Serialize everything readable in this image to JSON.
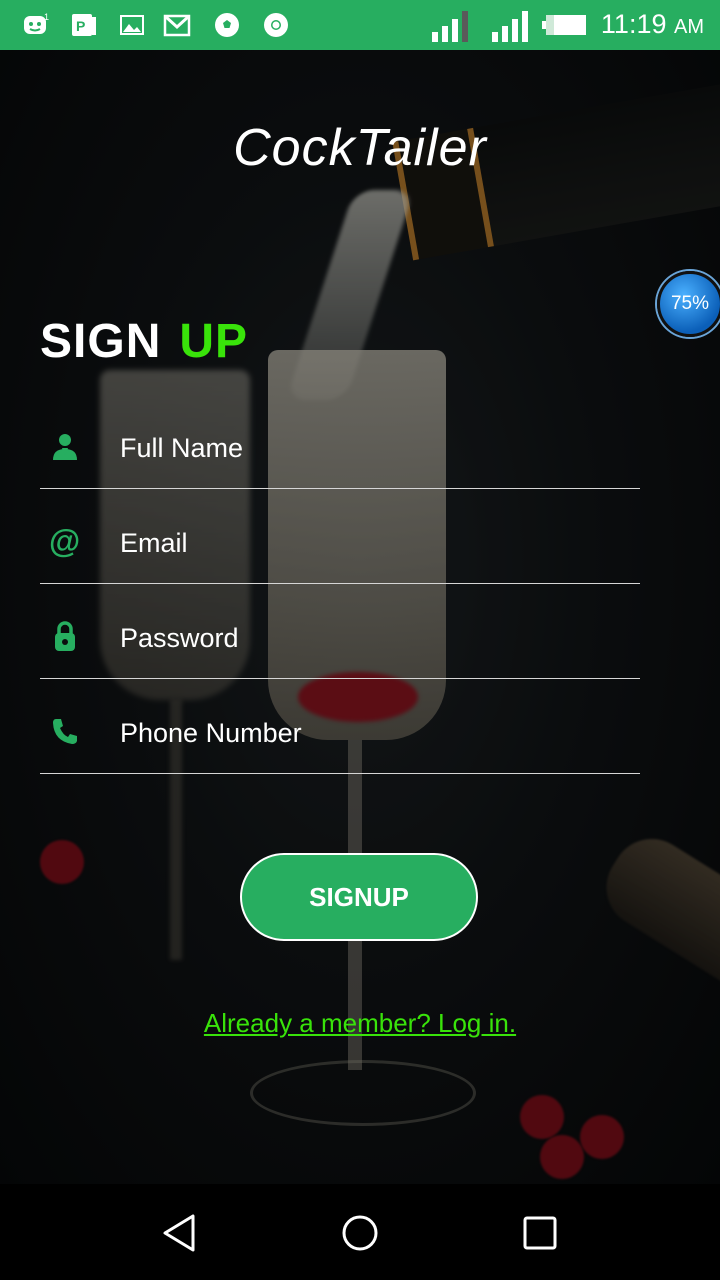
{
  "status_bar": {
    "time": "11:19",
    "ampm": "AM",
    "icons": [
      "messenger-icon",
      "pdf-icon",
      "gallery-icon",
      "gmail-icon",
      "soccer-icon",
      "chrome-icon",
      "signal-icon",
      "signal-icon",
      "battery-icon"
    ]
  },
  "app": {
    "title": "CockTailer"
  },
  "heading": {
    "word1": "SIGN",
    "word2": "UP"
  },
  "form": {
    "fields": [
      {
        "label": "Full Name",
        "icon": "person-icon"
      },
      {
        "label": "Email",
        "icon": "at-icon"
      },
      {
        "label": "Password",
        "icon": "lock-icon"
      },
      {
        "label": "Phone Number",
        "icon": "phone-icon"
      }
    ],
    "submit_label": "SIGNUP"
  },
  "login_link": "Already a member? Log in.",
  "battery_bubble": "75%",
  "colors": {
    "accent": "#27ae60",
    "highlight": "#39e30a"
  }
}
